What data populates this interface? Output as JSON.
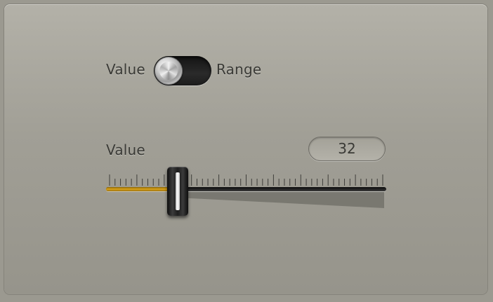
{
  "mode_toggle": {
    "left_label": "Value",
    "right_label": "Range",
    "state": "Value"
  },
  "value_slider": {
    "label": "Value",
    "readout": "32",
    "value": 32,
    "min": 0,
    "max": 127,
    "accent_color": "#d9a21a"
  }
}
